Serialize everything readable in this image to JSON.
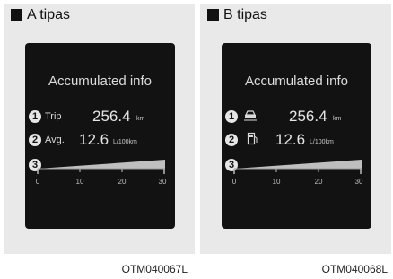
{
  "panels": [
    {
      "title": "A tipas",
      "screen": {
        "heading": "Accumulated info",
        "trip_label": "Trip",
        "trip_value": "256.4",
        "trip_unit": "km",
        "avg_label": "Avg.",
        "avg_value": "12.6",
        "avg_unit": "L/100km",
        "markers": [
          "1",
          "2",
          "3"
        ],
        "scale_ticks": [
          "0",
          "10",
          "20",
          "30"
        ]
      },
      "code": "OTM040067L"
    },
    {
      "title": "B tipas",
      "screen": {
        "heading": "Accumulated info",
        "trip_value": "256.4",
        "trip_unit": "km",
        "avg_value": "12.6",
        "avg_unit": "L/100km",
        "trip_icon": "car-road-icon",
        "avg_icon": "fuel-pump-icon",
        "markers": [
          "1",
          "2",
          "3"
        ],
        "scale_ticks": [
          "0",
          "10",
          "20",
          "30"
        ]
      },
      "code": "OTM040068L"
    }
  ]
}
